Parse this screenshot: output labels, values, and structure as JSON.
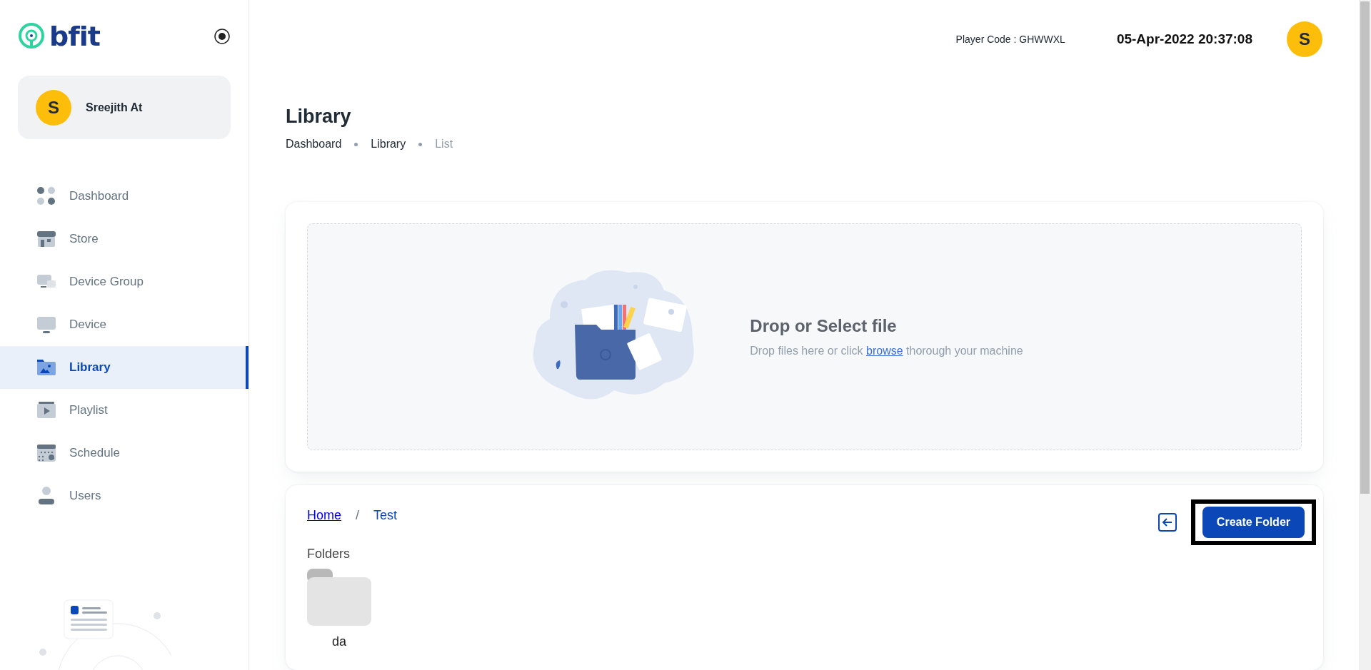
{
  "logo": {
    "text": "bfit"
  },
  "user": {
    "initial": "S",
    "name": "Sreejith At"
  },
  "sidebar": {
    "items": [
      {
        "label": "Dashboard",
        "kind": "dashboard",
        "selected": false
      },
      {
        "label": "Store",
        "kind": "store",
        "selected": false
      },
      {
        "label": "Device Group",
        "kind": "device-group",
        "selected": false
      },
      {
        "label": "Device",
        "kind": "device",
        "selected": false
      },
      {
        "label": "Library",
        "kind": "library",
        "selected": true
      },
      {
        "label": "Playlist",
        "kind": "playlist",
        "selected": false
      },
      {
        "label": "Schedule",
        "kind": "schedule",
        "selected": false
      },
      {
        "label": "Users",
        "kind": "users",
        "selected": false
      }
    ]
  },
  "header": {
    "player_code": "Player Code : GHWWXL",
    "datetime": "05-Apr-2022 20:37:08",
    "avatar_initial": "S"
  },
  "page": {
    "title": "Library",
    "breadcrumb": [
      {
        "label": "Dashboard",
        "current": false
      },
      {
        "label": "Library",
        "current": false
      },
      {
        "label": "List",
        "current": true
      }
    ]
  },
  "upload": {
    "title": "Drop or Select file",
    "text_before": "Drop files here or click",
    "link": "browse",
    "text_after": "thorough your machine"
  },
  "browser": {
    "path": [
      {
        "label": "Home",
        "kind": "link"
      },
      {
        "label": "Test",
        "kind": "current"
      }
    ],
    "separator": "/",
    "create_button": "Create Folder",
    "folders_label": "Folders",
    "folders": [
      {
        "name": "da"
      }
    ]
  }
}
